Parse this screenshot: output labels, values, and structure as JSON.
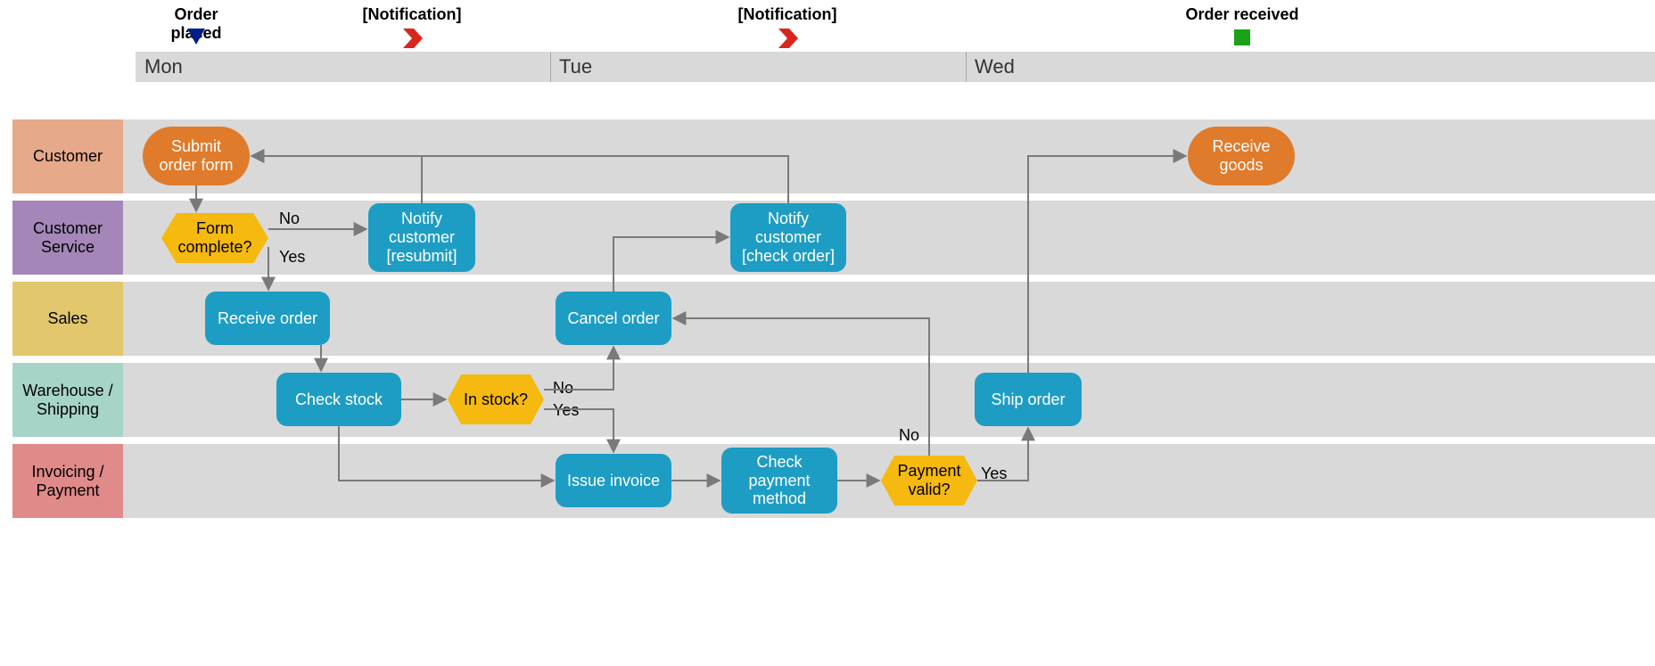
{
  "timeline": {
    "days": [
      "Mon",
      "Tue",
      "Wed"
    ],
    "markers": [
      {
        "id": "order-placed",
        "label": "Order placed",
        "type": "triangle"
      },
      {
        "id": "notification-1",
        "label": "[Notification]",
        "type": "chevron"
      },
      {
        "id": "notification-2",
        "label": "[Notification]",
        "type": "chevron"
      },
      {
        "id": "order-received",
        "label": "Order received",
        "type": "square"
      }
    ]
  },
  "lanes": [
    {
      "id": "customer",
      "label": "Customer",
      "color": "#e6a98a"
    },
    {
      "id": "customer-service",
      "label": "Customer Service",
      "color": "#a487b8"
    },
    {
      "id": "sales",
      "label": "Sales",
      "color": "#e2c76c"
    },
    {
      "id": "warehouse",
      "label": "Warehouse / Shipping",
      "color": "#a7d4c9"
    },
    {
      "id": "invoicing",
      "label": "Invoicing / Payment",
      "color": "#e08a8a"
    }
  ],
  "nodes": {
    "submit_order_form": {
      "lane": "customer",
      "type": "terminator",
      "text": "Submit order form"
    },
    "receive_goods": {
      "lane": "customer",
      "type": "terminator",
      "text": "Receive goods"
    },
    "form_complete": {
      "lane": "customer-service",
      "type": "decision",
      "text": "Form complete?"
    },
    "notify_resubmit": {
      "lane": "customer-service",
      "type": "process",
      "text": "Notify customer [resubmit]"
    },
    "notify_check_order": {
      "lane": "customer-service",
      "type": "process",
      "text": "Notify customer [check order]"
    },
    "receive_order": {
      "lane": "sales",
      "type": "process",
      "text": "Receive order"
    },
    "cancel_order": {
      "lane": "sales",
      "type": "process",
      "text": "Cancel order"
    },
    "check_stock": {
      "lane": "warehouse",
      "type": "process",
      "text": "Check stock"
    },
    "in_stock": {
      "lane": "warehouse",
      "type": "decision",
      "text": "In stock?"
    },
    "ship_order": {
      "lane": "warehouse",
      "type": "process",
      "text": "Ship order"
    },
    "issue_invoice": {
      "lane": "invoicing",
      "type": "process",
      "text": "Issue invoice"
    },
    "check_payment_method": {
      "lane": "invoicing",
      "type": "process",
      "text": "Check payment method"
    },
    "payment_valid": {
      "lane": "invoicing",
      "type": "decision",
      "text": "Payment valid?"
    }
  },
  "edges": [
    {
      "from": "submit_order_form",
      "to": "form_complete"
    },
    {
      "from": "form_complete",
      "to": "notify_resubmit",
      "label": "No"
    },
    {
      "from": "form_complete",
      "to": "receive_order",
      "label": "Yes"
    },
    {
      "from": "notify_resubmit",
      "to": "submit_order_form"
    },
    {
      "from": "receive_order",
      "to": "check_stock"
    },
    {
      "from": "check_stock",
      "to": "in_stock"
    },
    {
      "from": "check_stock",
      "to": "issue_invoice"
    },
    {
      "from": "in_stock",
      "to": "cancel_order",
      "label": "No"
    },
    {
      "from": "in_stock",
      "to": "issue_invoice",
      "label": "Yes"
    },
    {
      "from": "cancel_order",
      "to": "notify_check_order"
    },
    {
      "from": "notify_check_order",
      "to": "submit_order_form"
    },
    {
      "from": "issue_invoice",
      "to": "check_payment_method"
    },
    {
      "from": "check_payment_method",
      "to": "payment_valid"
    },
    {
      "from": "payment_valid",
      "to": "ship_order",
      "label": "Yes"
    },
    {
      "from": "payment_valid",
      "to": "cancel_order",
      "label": "No"
    },
    {
      "from": "ship_order",
      "to": "receive_goods"
    }
  ],
  "edge_labels": {
    "form_complete_no": "No",
    "form_complete_yes": "Yes",
    "in_stock_no": "No",
    "in_stock_yes": "Yes",
    "payment_valid_no": "No",
    "payment_valid_yes": "Yes"
  }
}
